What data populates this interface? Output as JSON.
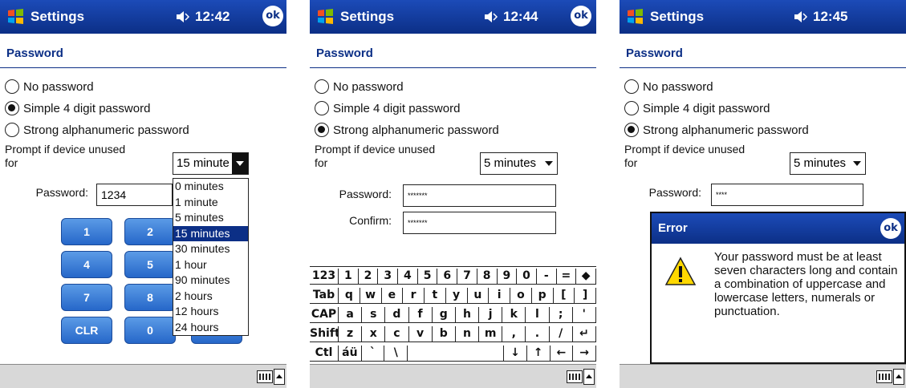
{
  "screens": [
    {
      "app_title": "Settings",
      "time": "12:42",
      "ok_label": "ok",
      "page_title": "Password",
      "radio_options": [
        {
          "label": "No password",
          "checked": false
        },
        {
          "label": "Simple 4 digit password",
          "checked": true
        },
        {
          "label": "Strong alphanumeric password",
          "checked": false
        }
      ],
      "prompt_label_line1": "Prompt if device unused",
      "prompt_label_line2": "for",
      "timeout_value": "15 minute",
      "password_label": "Password:",
      "password_value": "1234",
      "dropdown_options": [
        "0 minutes",
        "1 minute",
        "5 minutes",
        "15 minutes",
        "30 minutes",
        "1 hour",
        "90 minutes",
        "2 hours",
        "12 hours",
        "24 hours"
      ],
      "dropdown_selected": "15 minutes",
      "keypad": [
        "1",
        "2",
        "4",
        "5",
        "7",
        "8",
        "CLR",
        "0"
      ]
    },
    {
      "app_title": "Settings",
      "time": "12:44",
      "ok_label": "ok",
      "page_title": "Password",
      "radio_options": [
        {
          "label": "No password",
          "checked": false
        },
        {
          "label": "Simple 4 digit password",
          "checked": false
        },
        {
          "label": "Strong alphanumeric password",
          "checked": true
        }
      ],
      "prompt_label_line1": "Prompt if device unused",
      "prompt_label_line2": "for",
      "timeout_value": "5 minutes",
      "password_label": "Password:",
      "password_value": "*******",
      "confirm_label": "Confirm:",
      "confirm_value": "*******",
      "keyboard_rows": [
        [
          "123",
          "1",
          "2",
          "3",
          "4",
          "5",
          "6",
          "7",
          "8",
          "9",
          "0",
          "-",
          "=",
          "◆"
        ],
        [
          "Tab",
          "q",
          "w",
          "e",
          "r",
          "t",
          "y",
          "u",
          "i",
          "o",
          "p",
          "[",
          "]"
        ],
        [
          "CAP",
          "a",
          "s",
          "d",
          "f",
          "g",
          "h",
          "j",
          "k",
          "l",
          ";",
          "'"
        ],
        [
          "Shift",
          "z",
          "x",
          "c",
          "v",
          "b",
          "n",
          "m",
          ",",
          ".",
          "/",
          "↵"
        ],
        [
          "Ctl",
          "áü",
          "`",
          "\\",
          "",
          "↓",
          "↑",
          "←",
          "→"
        ]
      ]
    },
    {
      "app_title": "Settings",
      "time": "12:45",
      "page_title": "Password",
      "radio_options": [
        {
          "label": "No password",
          "checked": false
        },
        {
          "label": "Simple 4 digit password",
          "checked": false
        },
        {
          "label": "Strong alphanumeric password",
          "checked": true
        }
      ],
      "prompt_label_line1": "Prompt if device unused",
      "prompt_label_line2": "for",
      "timeout_value": "5 minutes",
      "password_label": "Password:",
      "password_value": "****",
      "error_dialog": {
        "title": "Error",
        "ok_label": "ok",
        "message": "Your password must be at least seven characters long and contain a combination of uppercase and lowercase letters, numerals or punctuation."
      }
    }
  ],
  "colors": {
    "titlebar": "#0c2f86",
    "selection": "#0c2f86",
    "keypad": "#2667c9",
    "taskbar": "#d8d8d8"
  }
}
